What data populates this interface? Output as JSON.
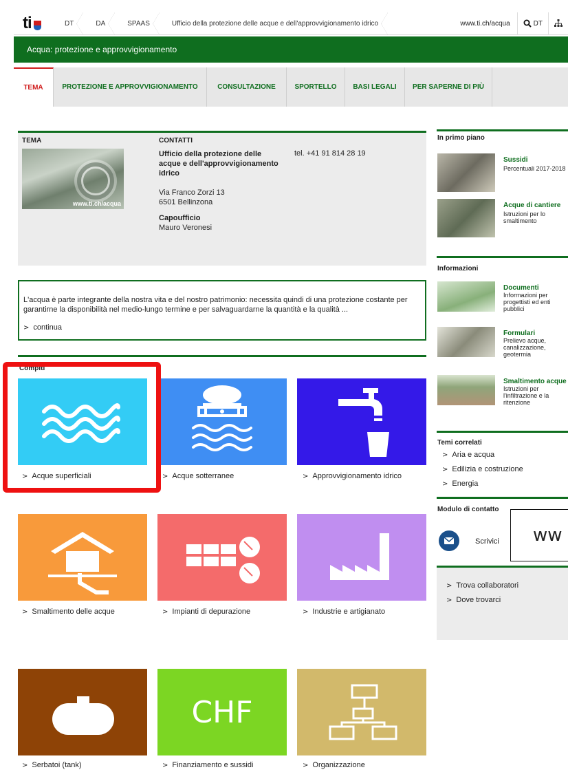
{
  "breadcrumb": {
    "logo": "ti",
    "items": [
      "DT",
      "DA",
      "SPAAS",
      "Ufficio della protezione delle acque e dell'approvvigionamento idrico"
    ],
    "url": "www.ti.ch/acqua",
    "search_label": "DT"
  },
  "section_title": "Acqua: protezione e approvvigionamento",
  "tabs": [
    {
      "label": "TEMA"
    },
    {
      "label": "PROTEZIONE E APPROVVIGIONAMENTO"
    },
    {
      "label": "CONSULTAZIONE"
    },
    {
      "label": "SPORTELLO"
    },
    {
      "label": "BASI LEGALI"
    },
    {
      "label": "PER SAPERNE DI PIÙ"
    }
  ],
  "tema": {
    "label": "TEMA",
    "image_tag": "www.ti.ch/acqua",
    "contatti_heading": "CONTATTI",
    "office": "Ufficio della protezione delle acque e dell'approvvigionamento idrico",
    "street": "Via Franco Zorzi 13",
    "city": "6501 Bellinzona",
    "tel": "tel. +41 91 814 28 19",
    "capo_heading": "Capoufficio",
    "capo_name": "Mauro Veronesi"
  },
  "intro": {
    "text": "L'acqua è parte integrante della nostra vita e del nostro patrimonio: necessita quindi di una protezione costante per garantirne la disponibilità nel medio-lungo termine e per salvaguardarne la quantità e la qualità ...",
    "more": "continua"
  },
  "compiti_label": "Compiti",
  "tiles": [
    {
      "label": "Acque superficiali",
      "color": "#33ccf5"
    },
    {
      "label": "Acque sotterranee",
      "color": "#3f8ef3"
    },
    {
      "label": "Approvvigionamento idrico",
      "color": "#3419e8"
    },
    {
      "label": "Smaltimento delle acque",
      "color": "#f89a3b"
    },
    {
      "label": "Impianti di depurazione",
      "color": "#f46b6b"
    },
    {
      "label": "Industrie e artigianato",
      "color": "#c08ef0"
    },
    {
      "label": "Serbatoi (tank)",
      "color": "#8e4306"
    },
    {
      "label": "Finanziamento e sussidi",
      "color": "#7cd623",
      "text": "CHF"
    },
    {
      "label": "Organizzazione",
      "color": "#d2b96b"
    }
  ],
  "sidebar": {
    "primo_piano": {
      "heading": "In primo piano",
      "items": [
        {
          "title": "Sussidi",
          "desc": "Percentuali 2017-2018"
        },
        {
          "title": "Acque di cantiere",
          "desc": "Istruzioni per lo smaltimento"
        }
      ]
    },
    "informazioni": {
      "heading": "Informazioni",
      "items": [
        {
          "title": "Documenti",
          "desc": "Informazioni per progettisti ed enti pubblici"
        },
        {
          "title": "Formulari",
          "desc": "Prelievo acque, canalizzazione, geotermia"
        },
        {
          "title": "Smaltimento acque",
          "desc": "Istruzioni per l'infiltrazione e la ritenzione"
        }
      ]
    },
    "temi_correlati": {
      "heading": "Temi correlati",
      "links": [
        "Aria e acqua",
        "Edilizia e costruzione",
        "Energia"
      ]
    },
    "modulo": {
      "heading": "Modulo di contatto",
      "link": "Scrivici"
    },
    "grey_links": [
      "Trova collaboratori",
      "Dove trovarci"
    ]
  },
  "overlay_text": "ww"
}
